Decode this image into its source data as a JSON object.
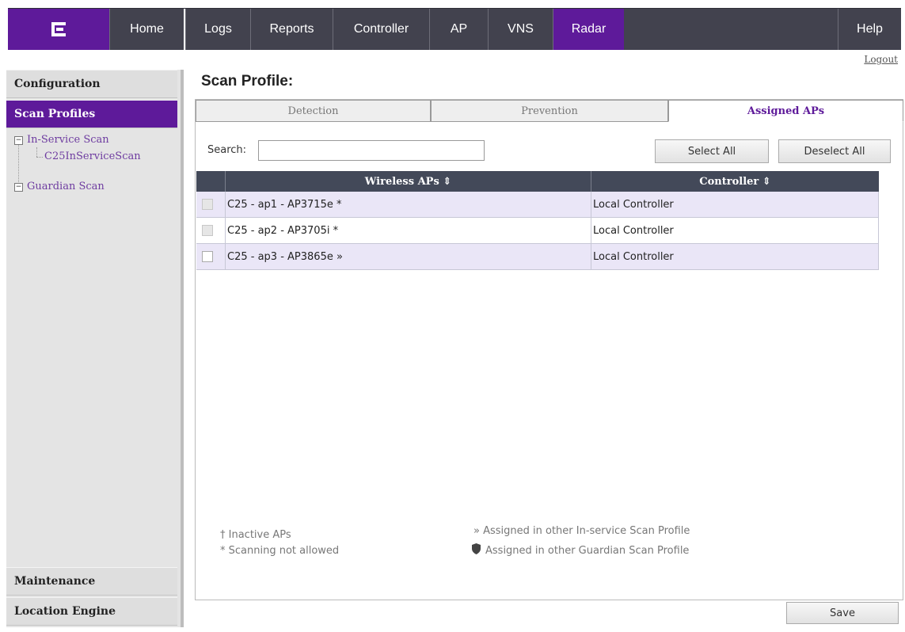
{
  "nav": {
    "items": [
      {
        "label": "Home"
      },
      {
        "label": "Logs"
      },
      {
        "label": "Reports"
      },
      {
        "label": "Controller"
      },
      {
        "label": "AP"
      },
      {
        "label": "VNS"
      },
      {
        "label": "Radar",
        "active": true
      },
      {
        "label": "Help"
      }
    ],
    "logout": "Logout"
  },
  "sidebar": {
    "configuration": "Configuration",
    "scan_profiles": "Scan Profiles",
    "tree": {
      "in_service": "In-Service Scan",
      "in_service_child": "C25InServiceScan",
      "guardian": "Guardian Scan"
    },
    "maintenance": "Maintenance",
    "location_engine": "Location Engine"
  },
  "main": {
    "title": "Scan Profile:",
    "tabs": [
      {
        "label": "Detection"
      },
      {
        "label": "Prevention"
      },
      {
        "label": "Assigned APs",
        "active": true
      }
    ],
    "search": {
      "label": "Search:",
      "value": ""
    },
    "select_all": "Select All",
    "deselect_all": "Deselect All",
    "table": {
      "headers": [
        "Wireless APs ⇕",
        "Controller ⇕"
      ],
      "rows": [
        {
          "ap": "C25 - ap1 - AP3715e *",
          "controller": "Local Controller",
          "checkbox": "disabled"
        },
        {
          "ap": "C25 - ap2 - AP3705i *",
          "controller": "Local Controller",
          "checkbox": "disabled"
        },
        {
          "ap": "C25 - ap3 - AP3865e »",
          "controller": "Local Controller",
          "checkbox": "enabled"
        }
      ]
    },
    "legend": {
      "inactive": "† Inactive APs",
      "scanning": "* Scanning not allowed",
      "in_service": "» Assigned in other In-service Scan Profile",
      "guardian": "Assigned in other Guardian Scan Profile"
    },
    "save": "Save"
  },
  "colors": {
    "brand": "#5e1a9a",
    "nav": "#42424e",
    "table_header": "#434959",
    "row_alt": "#eae6f7"
  }
}
